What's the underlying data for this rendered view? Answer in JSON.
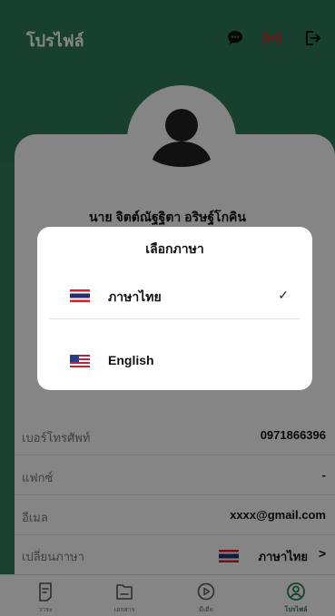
{
  "header": {
    "title": "โปรไฟล์",
    "icons": [
      "chat-icon",
      "broadcast-icon",
      "logout-icon"
    ]
  },
  "profile": {
    "name": "นาย จิตต์ณัฐฐิตา อริษฐ์โกคิน",
    "rows": [
      {
        "label": "เบอร์โทรศัพท์",
        "value": "0971866396"
      },
      {
        "label": "แฟกซ์",
        "value": "-"
      },
      {
        "label": "อีเมล",
        "value": "xxxx@gmail.com"
      }
    ],
    "language_row": {
      "label": "เปลี่ยนภาษา",
      "value": "ภาษาไทย",
      "chevron": ">"
    }
  },
  "modal": {
    "title": "เลือกภาษา",
    "options": [
      {
        "label": "ภาษาไทย",
        "flag": "thailand-flag",
        "selected": true,
        "check": "✓"
      },
      {
        "label": "English",
        "flag": "usa-flag",
        "selected": false
      }
    ]
  },
  "bottom_nav": {
    "items": [
      {
        "label": "วาระ",
        "icon": "agenda-icon"
      },
      {
        "label": "เอกสาร",
        "icon": "folder-icon"
      },
      {
        "label": "มีเดีย",
        "icon": "play-icon"
      },
      {
        "label": "โปรไฟล์",
        "icon": "profile-icon",
        "active": true
      }
    ]
  },
  "colors": {
    "primary": "#2f7b5a",
    "accent_red": "#d81e2a",
    "overlay": "rgba(0,0,0,0.48)"
  }
}
